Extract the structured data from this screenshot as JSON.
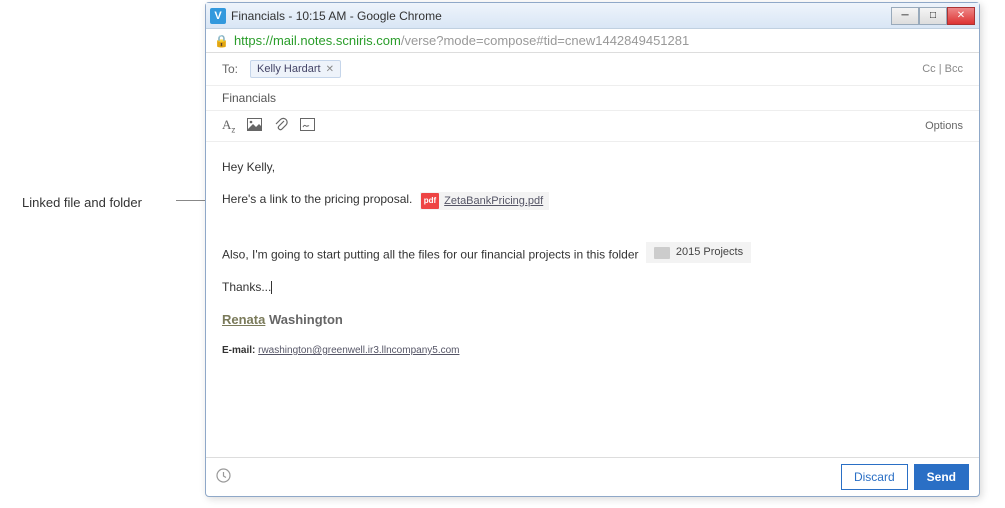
{
  "annotation": "Linked file and folder",
  "window": {
    "title": "Financials - 10:15 AM - Google Chrome",
    "icon_label": "V"
  },
  "url": {
    "secure": "https://mail.notes.scniris.com",
    "rest": "/verse?mode=compose#tid=cnew1442849451281"
  },
  "compose": {
    "to_label": "To:",
    "recipient": "Kelly Hardart",
    "cc_label": "Cc",
    "bcc_label": "Bcc",
    "subject": "Financials",
    "options_label": "Options"
  },
  "body": {
    "greeting": "Hey Kelly,",
    "line1_before": "Here's a link to the pricing proposal.",
    "pdf_name": "ZetaBankPricing.pdf",
    "pdf_badge": "pdf",
    "line2_before": "Also, I'm going to start putting all the files for our financial projects in this folder",
    "folder_name": "2015 Projects",
    "thanks": "Thanks...",
    "sig_first": "Renata",
    "sig_last": " Washington",
    "sig_email_label": "E-mail: ",
    "sig_email": "rwashington@greenwell.ir3.llncompany5.com"
  },
  "footer": {
    "discard": "Discard",
    "send": "Send"
  }
}
